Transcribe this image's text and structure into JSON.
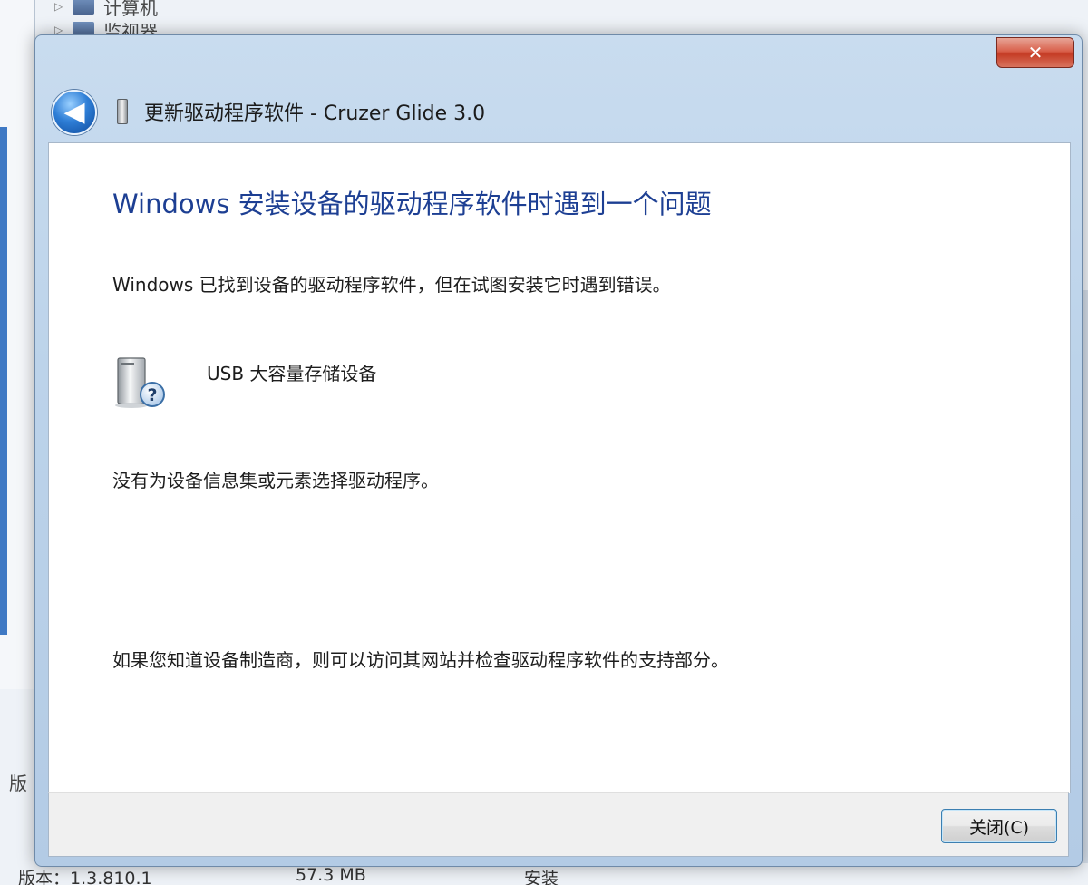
{
  "background": {
    "tree_items": [
      "计算机",
      "监视器"
    ],
    "side_labels": [
      "版"
    ],
    "bottom_row": [
      "版本：1.3.810.1",
      "57.3 MB",
      "安装"
    ]
  },
  "dialog": {
    "close_glyph": "✕",
    "back_glyph": "◀",
    "title": "更新驱动程序软件 - Cruzer Glide 3.0",
    "heading": "Windows 安装设备的驱动程序软件时遇到一个问题",
    "found_message": "Windows 已找到设备的驱动程序软件，但在试图安装它时遇到错误。",
    "device_name": "USB 大容量存储设备",
    "error_detail": "没有为设备信息集或元素选择驱动程序。",
    "help_message": "如果您知道设备制造商，则可以访问其网站并检查驱动程序软件的支持部分。",
    "close_button_label": "关闭(C)"
  },
  "icons": {
    "back": "back-arrow-icon",
    "title_device": "usb-drive-icon",
    "device": "device-unknown-icon",
    "window_close": "close-icon"
  },
  "colors": {
    "heading": "#1d3f93",
    "window_close": "#c53c25",
    "frame": "#bcd3ea"
  }
}
